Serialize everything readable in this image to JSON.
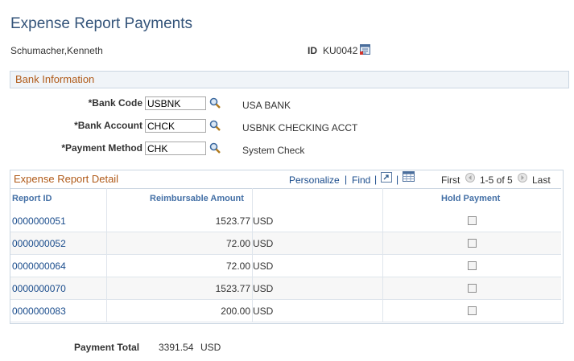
{
  "page": {
    "title": "Expense Report Payments"
  },
  "employee": {
    "name": "Schumacher,Kenneth",
    "id_label": "ID",
    "id_value": "KU0042"
  },
  "bank": {
    "section_title": "Bank Information",
    "fields": [
      {
        "label": "*Bank Code",
        "value": "USBNK",
        "description": "USA BANK"
      },
      {
        "label": "*Bank Account",
        "value": "CHCK",
        "description": "USBNK CHECKING ACCT"
      },
      {
        "label": "*Payment Method",
        "value": "CHK",
        "description": "System Check"
      }
    ]
  },
  "detail": {
    "section_title": "Expense Report Detail",
    "toolbar": {
      "personalize": "Personalize",
      "separator": "|",
      "find": "Find",
      "first": "First",
      "range": "1-5 of 5",
      "last": "Last"
    },
    "columns": {
      "report_id": "Report ID",
      "amount": "Reimbursable Amount",
      "hold": "Hold Payment"
    },
    "rows": [
      {
        "report_id": "0000000051",
        "amount": "1523.77",
        "currency": "USD",
        "hold": false
      },
      {
        "report_id": "0000000052",
        "amount": "72.00",
        "currency": "USD",
        "hold": false
      },
      {
        "report_id": "0000000064",
        "amount": "72.00",
        "currency": "USD",
        "hold": false
      },
      {
        "report_id": "0000000070",
        "amount": "1523.77",
        "currency": "USD",
        "hold": false
      },
      {
        "report_id": "0000000083",
        "amount": "200.00",
        "currency": "USD",
        "hold": false
      }
    ]
  },
  "total": {
    "label": "Payment Total",
    "amount": "3391.54",
    "currency": "USD"
  },
  "icons": [
    "lookup-icon",
    "id-detail-icon",
    "zoom-grid-icon",
    "download-grid-icon",
    "prev-arrow-icon",
    "next-arrow-icon"
  ],
  "colors": {
    "title": "#34547a",
    "section_title": "#b05a18",
    "link": "#1a4c8c",
    "column_header": "#4470a6"
  }
}
